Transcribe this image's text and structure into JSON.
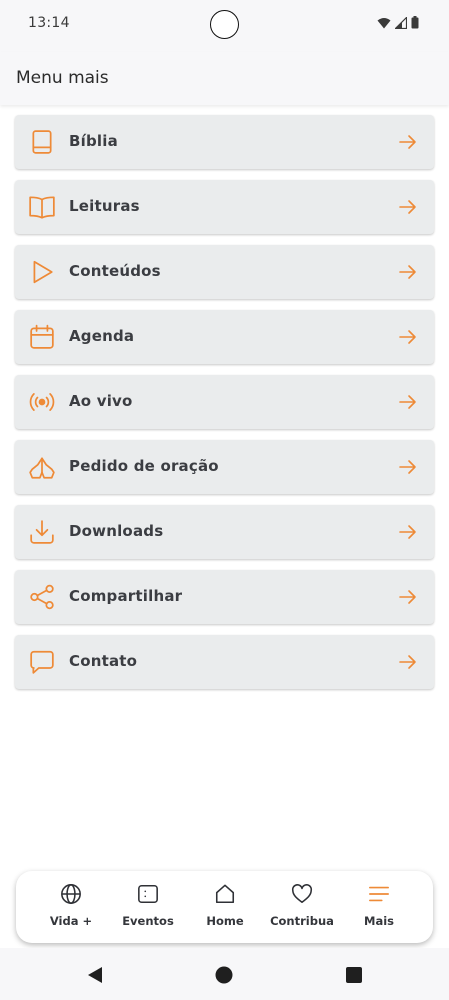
{
  "status_bar": {
    "time": "13:14"
  },
  "header": {
    "title": "Menu mais"
  },
  "accent_color": "#ee8a37",
  "menu": {
    "items": [
      {
        "label": "Bíblia",
        "icon": "book-icon"
      },
      {
        "label": "Leituras",
        "icon": "open-book-icon"
      },
      {
        "label": "Conteúdos",
        "icon": "play-icon"
      },
      {
        "label": "Agenda",
        "icon": "calendar-icon"
      },
      {
        "label": "Ao vivo",
        "icon": "broadcast-icon"
      },
      {
        "label": "Pedido de oração",
        "icon": "praying-hands-icon"
      },
      {
        "label": "Downloads",
        "icon": "download-icon"
      },
      {
        "label": "Compartilhar",
        "icon": "share-icon"
      },
      {
        "label": "Contato",
        "icon": "chat-bubble-icon"
      }
    ]
  },
  "bottom_nav": {
    "items": [
      {
        "label": "Vida +",
        "icon": "globe-icon"
      },
      {
        "label": "Eventos",
        "icon": "event-card-icon"
      },
      {
        "label": "Home",
        "icon": "home-icon"
      },
      {
        "label": "Contribua",
        "icon": "heart-icon"
      },
      {
        "label": "Mais",
        "icon": "menu-lines-icon",
        "active": true
      }
    ]
  }
}
